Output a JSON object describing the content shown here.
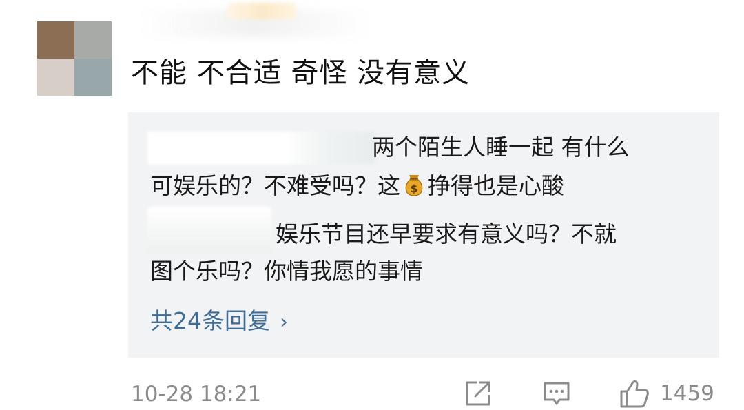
{
  "comment": {
    "text": "不能 不合适 奇怪 没有意义"
  },
  "replies": [
    {
      "line1": "两个陌生人睡一起 有什么",
      "line2_a": "可娱乐的？不难受吗？这",
      "line2_b": "挣得也是心酸",
      "emoji": "money-bag-icon"
    },
    {
      "line1": "娱乐节目还早要求有意义吗？不就",
      "line2": "图个乐吗？你情我愿的事情"
    }
  ],
  "more_replies": {
    "label": "共24条回复",
    "chevron": "›"
  },
  "footer": {
    "timestamp": "10-28 18:21",
    "like_count": "1459",
    "icons": [
      "share-icon",
      "reply-icon",
      "like-icon"
    ]
  },
  "colors": {
    "link": "#3f6d94",
    "muted": "#8b8b8b",
    "reply_bg": "#f2f3f5"
  }
}
